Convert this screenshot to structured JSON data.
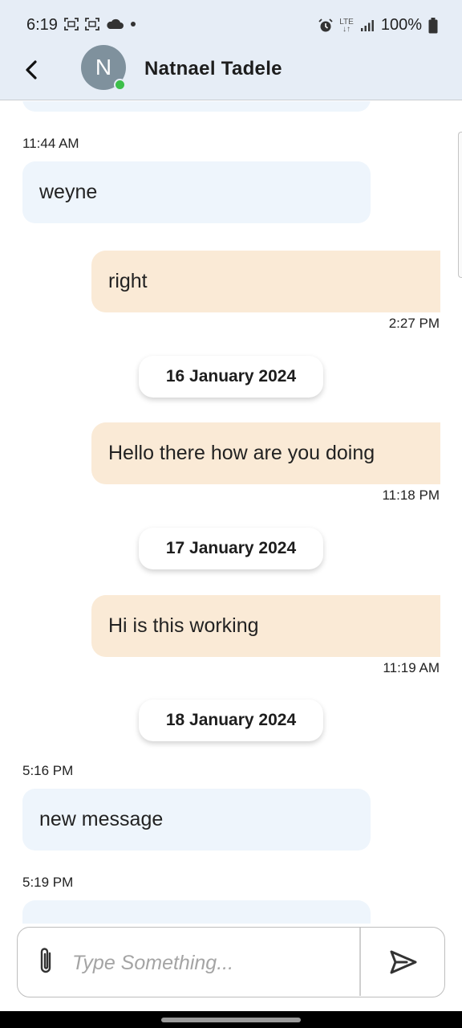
{
  "status_bar": {
    "time": "6:19",
    "battery": "100%",
    "network": "LTE"
  },
  "header": {
    "avatar_initial": "N",
    "contact_name": "Natnael Tadele",
    "online": true
  },
  "messages": [
    {
      "direction": "in",
      "time": "11:44 AM",
      "text": "weyne"
    },
    {
      "direction": "out",
      "text": "right",
      "time": "2:27 PM"
    },
    {
      "date": "16 January 2024"
    },
    {
      "direction": "out",
      "text": "Hello there how are you doing",
      "time": "11:18 PM"
    },
    {
      "date": "17 January 2024"
    },
    {
      "direction": "out",
      "text": "Hi is this working",
      "time": "11:19 AM"
    },
    {
      "date": "18 January 2024"
    },
    {
      "direction": "in",
      "time": "5:16 PM",
      "text": "new message"
    },
    {
      "direction": "in",
      "time": "5:19 PM",
      "text": ""
    }
  ],
  "composer": {
    "placeholder": "Type Something...",
    "value": ""
  },
  "colors": {
    "header_bg": "#e6edf6",
    "incoming_bubble": "#eef5fc",
    "outgoing_bubble": "#faead6",
    "online_indicator": "#3dbf4a",
    "avatar_bg": "#7f919d"
  }
}
